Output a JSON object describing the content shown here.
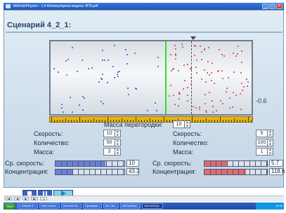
{
  "window": {
    "title": "MAFizikPhysics - 1.4 Молекулярная модель ЭПЗ.pdf"
  },
  "scenario_title": "Сценарий 4_2_1:",
  "partition": {
    "mass_label": "Масса перегородки:",
    "mass_value": "10"
  },
  "position_readout": "-0.6",
  "left": {
    "speed_label": "Скорость:",
    "speed_value": "10",
    "count_label": "Количество:",
    "count_value": "50",
    "mass_label": "Масса:",
    "mass_value": "3",
    "avg_speed_label": "Ср. скорость:",
    "avg_speed_value": "10",
    "concentration_label": "Концентрация:",
    "concentration_value": "43.2",
    "speed_fill": 0.72,
    "concentration_fill": 0.24,
    "particle_color": "#3b4bd6"
  },
  "right": {
    "speed_label": "Скорость:",
    "speed_value": "5",
    "count_label": "Количество:",
    "count_value": "100",
    "mass_label": "Масса:",
    "mass_value": "1",
    "avg_speed_label": "Ср. скорость:",
    "avg_speed_value": "5.7",
    "concentration_label": "Концентрация:",
    "concentration_value": "118.6",
    "speed_fill": 0.36,
    "concentration_fill": 0.66,
    "particle_color": "#d23a3a"
  },
  "controls": {
    "stop_icon": "stop-icon",
    "pause_icon": "pause-icon",
    "play_icon": "play-icon",
    "play_color": "#7fd3e8"
  },
  "divider_color": "#33dd22",
  "taskbar": {
    "start_label": "Пуск",
    "items": [
      "1. ОБЩАЯ Ф...",
      "Total Comma...",
      "Microsoft Wo...",
      "Проводник...",
      "На 1 Заг...",
      "MAFizikPhys...",
      "MAFizikPhysi..."
    ],
    "active_index": 6,
    "tray_time": "10:30"
  }
}
